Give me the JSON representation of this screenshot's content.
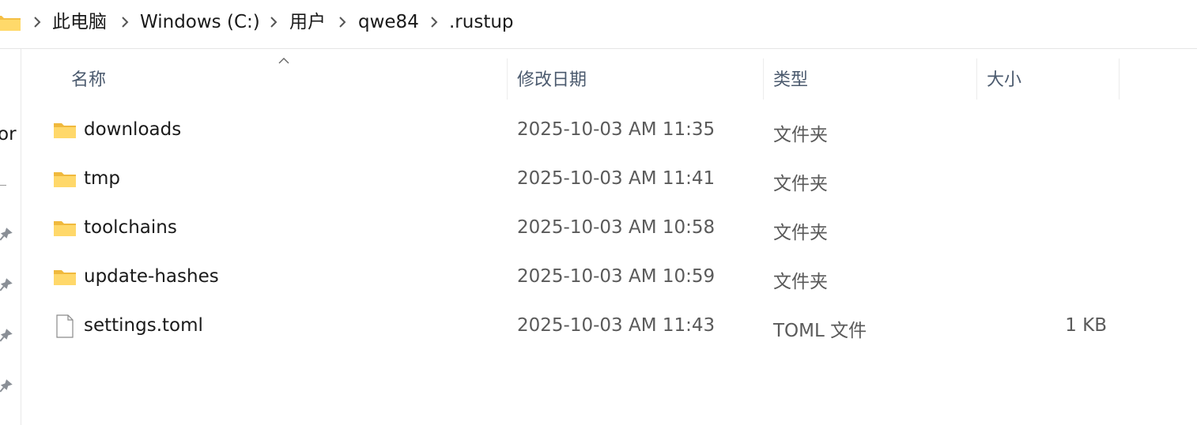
{
  "breadcrumb": {
    "items": [
      "此电脑",
      "Windows (C:)",
      "用户",
      "qwe84",
      ".rustup"
    ]
  },
  "left_pane": {
    "partial_text": "or"
  },
  "columns": {
    "name": "名称",
    "modified": "修改日期",
    "type": "类型",
    "size": "大小",
    "sort_indicator": "ascending"
  },
  "files": [
    {
      "name": "downloads",
      "modified": "2025-10-03 AM 11:35",
      "type": "文件夹",
      "size": "",
      "icon": "folder-icon"
    },
    {
      "name": "tmp",
      "modified": "2025-10-03 AM 11:41",
      "type": "文件夹",
      "size": "",
      "icon": "folder-icon"
    },
    {
      "name": "toolchains",
      "modified": "2025-10-03 AM 10:58",
      "type": "文件夹",
      "size": "",
      "icon": "folder-icon"
    },
    {
      "name": "update-hashes",
      "modified": "2025-10-03 AM 10:59",
      "type": "文件夹",
      "size": "",
      "icon": "folder-icon"
    },
    {
      "name": "settings.toml",
      "modified": "2025-10-03 AM 11:43",
      "type": "TOML 文件",
      "size": "1 KB",
      "icon": "file-icon"
    }
  ],
  "colors": {
    "folder_yellow": "#f8c94a",
    "folder_light": "#ffe08a",
    "header_text": "#4b5a6e"
  }
}
